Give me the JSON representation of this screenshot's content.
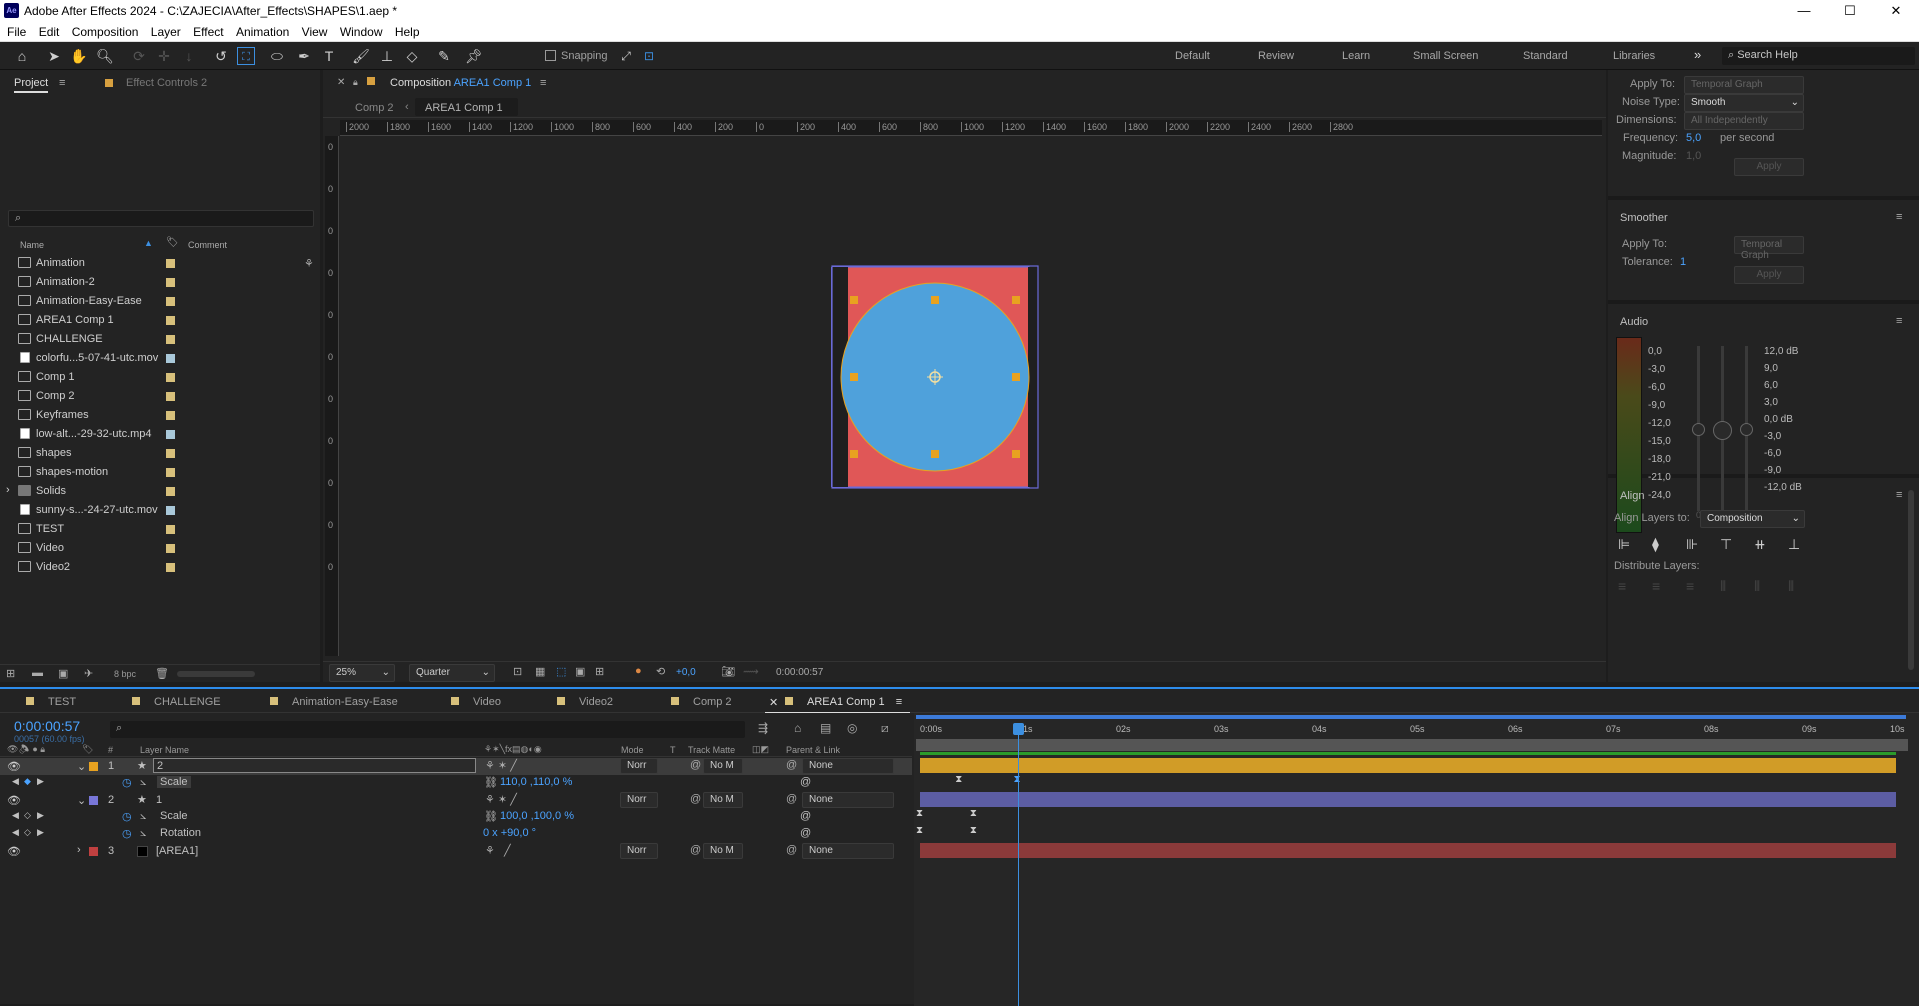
{
  "window": {
    "title": "Adobe After Effects 2024 - C:\\ZAJECIA\\After_Effects\\SHAPES\\1.aep *",
    "app_icon": "Ae",
    "minimize": "—",
    "maximize": "☐",
    "close": "✕"
  },
  "menu": [
    "File",
    "Edit",
    "Composition",
    "Layer",
    "Effect",
    "Animation",
    "View",
    "Window",
    "Help"
  ],
  "toolbar": {
    "snapping_label": "Snapping",
    "workspaces": [
      "Default",
      "Review",
      "Learn",
      "Small Screen",
      "Standard",
      "Libraries"
    ],
    "more": "»",
    "search_placeholder": "Search Help"
  },
  "project": {
    "tab_project": "Project",
    "tab_effect": "Effect Controls 2",
    "search_placeholder": "",
    "col_name": "Name",
    "col_comment": "Comment",
    "items": [
      {
        "name": "Animation",
        "type": "comp",
        "color": "#d7c07b"
      },
      {
        "name": "Animation-2",
        "type": "comp",
        "color": "#d7c07b"
      },
      {
        "name": "Animation-Easy-Ease",
        "type": "comp",
        "color": "#d7c07b"
      },
      {
        "name": "AREA1 Comp 1",
        "type": "comp",
        "color": "#d7c07b"
      },
      {
        "name": "CHALLENGE",
        "type": "comp",
        "color": "#d7c07b"
      },
      {
        "name": "colorfu...5-07-41-utc.mov",
        "type": "footage",
        "color": "#a9c8d9"
      },
      {
        "name": "Comp 1",
        "type": "comp",
        "color": "#d7c07b"
      },
      {
        "name": "Comp 2",
        "type": "comp",
        "color": "#d7c07b"
      },
      {
        "name": "Keyframes",
        "type": "comp",
        "color": "#d7c07b"
      },
      {
        "name": "low-alt...-29-32-utc.mp4",
        "type": "footage",
        "color": "#a9c8d9"
      },
      {
        "name": "shapes",
        "type": "comp",
        "color": "#d7c07b"
      },
      {
        "name": "shapes-motion",
        "type": "comp",
        "color": "#d7c07b"
      },
      {
        "name": "Solids",
        "type": "folder",
        "color": "#d7c07b"
      },
      {
        "name": "sunny-s...-24-27-utc.mov",
        "type": "footage",
        "color": "#a9c8d9"
      },
      {
        "name": "TEST",
        "type": "comp",
        "color": "#d7c07b"
      },
      {
        "name": "Video",
        "type": "comp",
        "color": "#d7c07b"
      },
      {
        "name": "Video2",
        "type": "comp",
        "color": "#d7c07b"
      }
    ],
    "bpc": "8 bpc"
  },
  "comp_panel": {
    "title_prefix": "Composition",
    "title_comp": "AREA1 Comp 1",
    "breadcrumb_parent": "Comp 2",
    "breadcrumb_current": "AREA1 Comp 1",
    "ruler_h": [
      "2000",
      "1800",
      "1600",
      "1400",
      "1200",
      "1000",
      "800",
      "600",
      "400",
      "200",
      "0",
      "200",
      "400",
      "600",
      "800",
      "1000",
      "1200",
      "1400",
      "1600",
      "1800",
      "2000",
      "2200",
      "2400",
      "2600",
      "2800"
    ],
    "ruler_v": [
      "0",
      "0",
      "0",
      "0",
      "0",
      "0",
      "0",
      "0",
      "0",
      "0",
      "0"
    ],
    "zoom": "25%",
    "resolution": "Quarter",
    "exposure": "+0,0",
    "timecode": "0:00:00:57",
    "colors": {
      "background": "#e05757",
      "circle": "#4fa1db",
      "handle": "#e8a220",
      "bbox": "#6a6ad8"
    }
  },
  "right_panel": {
    "wiggler": {
      "apply_to_label": "Apply To:",
      "apply_to_value": "Temporal Graph",
      "noise_label": "Noise Type:",
      "noise_value": "Smooth",
      "dim_label": "Dimensions:",
      "dim_value": "All Independently",
      "freq_label": "Frequency:",
      "freq_value": "5,0",
      "freq_unit": "per second",
      "mag_label": "Magnitude:",
      "mag_value": "1,0",
      "apply": "Apply"
    },
    "smoother": {
      "title": "Smoother",
      "apply_to_label": "Apply To:",
      "apply_to_value": "Temporal Graph",
      "tol_label": "Tolerance:",
      "tol_value": "1",
      "apply": "Apply"
    },
    "audio": {
      "title": "Audio",
      "left": [
        "0,0",
        "-3,0",
        "-6,0",
        "-9,0",
        "-12,0",
        "-15,0",
        "-18,0",
        "-21,0",
        "-24,0"
      ],
      "right": [
        "12,0 dB",
        "9,0",
        "6,0",
        "3,0",
        "0,0 dB",
        "-3,0",
        "-6,0",
        "-9,0",
        "-12,0 dB"
      ],
      "bottom_left": "0",
      "bottom_right": "0"
    },
    "align": {
      "title": "Align",
      "align_to_label": "Align Layers to:",
      "align_to_value": "Composition",
      "distribute_label": "Distribute Layers:"
    }
  },
  "timeline": {
    "tabs": [
      {
        "name": "TEST",
        "color": "#d7c07b"
      },
      {
        "name": "CHALLENGE",
        "color": "#d7c07b"
      },
      {
        "name": "Animation-Easy-Ease",
        "color": "#d7c07b"
      },
      {
        "name": "Video",
        "color": "#d7c07b"
      },
      {
        "name": "Video2",
        "color": "#d7c07b"
      },
      {
        "name": "Comp 2",
        "color": "#d7c07b"
      },
      {
        "name": "AREA1 Comp 1",
        "color": "#d7c07b",
        "active": true
      }
    ],
    "timecode": "0:00:00:57",
    "fps": "00057 (60.00 fps)",
    "headers": {
      "num": "#",
      "layer_name": "Layer Name",
      "mode": "Mode",
      "t": "T",
      "track_matte": "Track Matte",
      "parent": "Parent & Link"
    },
    "layers": [
      {
        "num": "1",
        "name": "2",
        "color": "#e8a220",
        "mode": "Norr",
        "matte": "No M",
        "parent": "None",
        "prop": "Scale",
        "prop_value": "110,0 ,110,0 %"
      },
      {
        "num": "2",
        "name": "1",
        "color": "#7876d8",
        "mode": "Norr",
        "matte": "No M",
        "parent": "None",
        "props": [
          {
            "name": "Scale",
            "value": "100,0 ,100,0 %"
          },
          {
            "name": "Rotation",
            "value": "0 x +90,0 °"
          }
        ]
      },
      {
        "num": "3",
        "name": "[AREA1]",
        "color": "#c04040",
        "mode": "Norr",
        "matte": "No M",
        "parent": "None"
      }
    ],
    "ruler": [
      "0:00s",
      "01s",
      "02s",
      "03s",
      "04s",
      "05s",
      "06s",
      "07s",
      "08s",
      "09s",
      "10s"
    ],
    "current_time_fraction": 0.0995,
    "bar_colors": {
      "layer1": "#d19c27",
      "layer2": "#5c5da3",
      "layer3": "#8b3a3a",
      "work": "#2b9a2b"
    }
  }
}
